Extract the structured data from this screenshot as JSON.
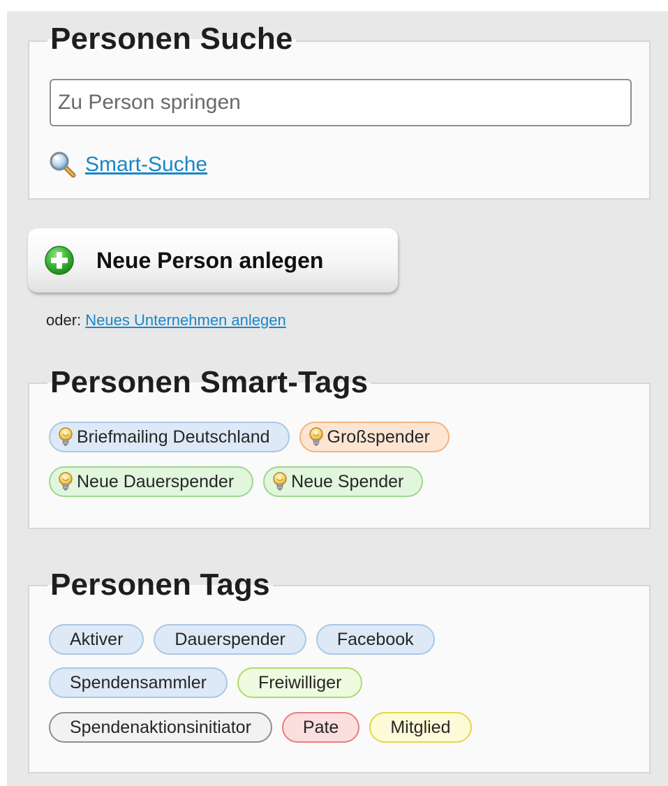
{
  "search": {
    "title": "Personen Suche",
    "placeholder": "Zu Person springen",
    "smart_search_label": "Smart-Suche"
  },
  "new_person": {
    "button_label": "Neue Person anlegen",
    "alt_prefix": "oder:",
    "alt_link": "Neues Unternehmen anlegen"
  },
  "smart_tags": {
    "title": "Personen Smart-Tags",
    "rows": [
      [
        {
          "label": "Briefmailing Deutschland",
          "color": "blue"
        },
        {
          "label": "Großspender",
          "color": "orange"
        }
      ],
      [
        {
          "label": "Neue Dauerspender",
          "color": "green"
        },
        {
          "label": "Neue Spender",
          "color": "green"
        }
      ]
    ]
  },
  "tags": {
    "title": "Personen Tags",
    "rows": [
      [
        {
          "label": "Aktiver",
          "color": "blue"
        },
        {
          "label": "Dauerspender",
          "color": "blue"
        },
        {
          "label": "Facebook",
          "color": "blue"
        }
      ],
      [
        {
          "label": "Spendensammler",
          "color": "blue"
        },
        {
          "label": "Freiwilliger",
          "color": "lime"
        }
      ],
      [
        {
          "label": "Spendenaktionsinitiator",
          "color": "gray"
        },
        {
          "label": "Pate",
          "color": "red"
        },
        {
          "label": "Mitglied",
          "color": "yellow"
        }
      ]
    ]
  },
  "colors": {
    "link": "#1a86c8",
    "plus_icon": "#2ea52e",
    "panel_background": "#e8e8e8"
  }
}
